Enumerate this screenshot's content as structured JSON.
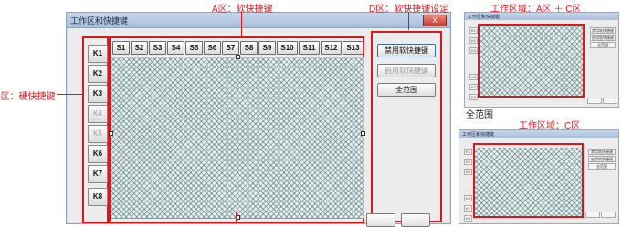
{
  "annotations": {
    "a_zone": "A区：软快捷键",
    "b_zone": "B区：硬快捷键",
    "d_zone": "D区：软快捷键设定",
    "top_thumb_title": "工作区域：A区 ＋ C区",
    "mid_caption": "全范围",
    "bottom_thumb_title": "工作区域：C区"
  },
  "dialog": {
    "title": "工作区和快捷键",
    "close_label": "X",
    "hard_keys": [
      {
        "label": "K1",
        "enabled": true
      },
      {
        "label": "K2",
        "enabled": true
      },
      {
        "label": "K3",
        "enabled": true
      },
      {
        "label": "K4",
        "enabled": false
      },
      {
        "label": "K5",
        "enabled": false
      },
      {
        "label": "K6",
        "enabled": true
      },
      {
        "label": "K7",
        "enabled": true
      },
      {
        "label": "K8",
        "enabled": true
      }
    ],
    "soft_keys": [
      "S1",
      "S2",
      "S3",
      "S4",
      "S5",
      "S6",
      "S7",
      "S8",
      "S9",
      "S10",
      "S11",
      "S12",
      "S13"
    ],
    "side_buttons": {
      "disable": "禁用软快捷键",
      "enable": "启用软快捷键",
      "full": "全范围"
    }
  },
  "colors": {
    "accent_red": "#e0161c",
    "hatch": "#466969"
  }
}
